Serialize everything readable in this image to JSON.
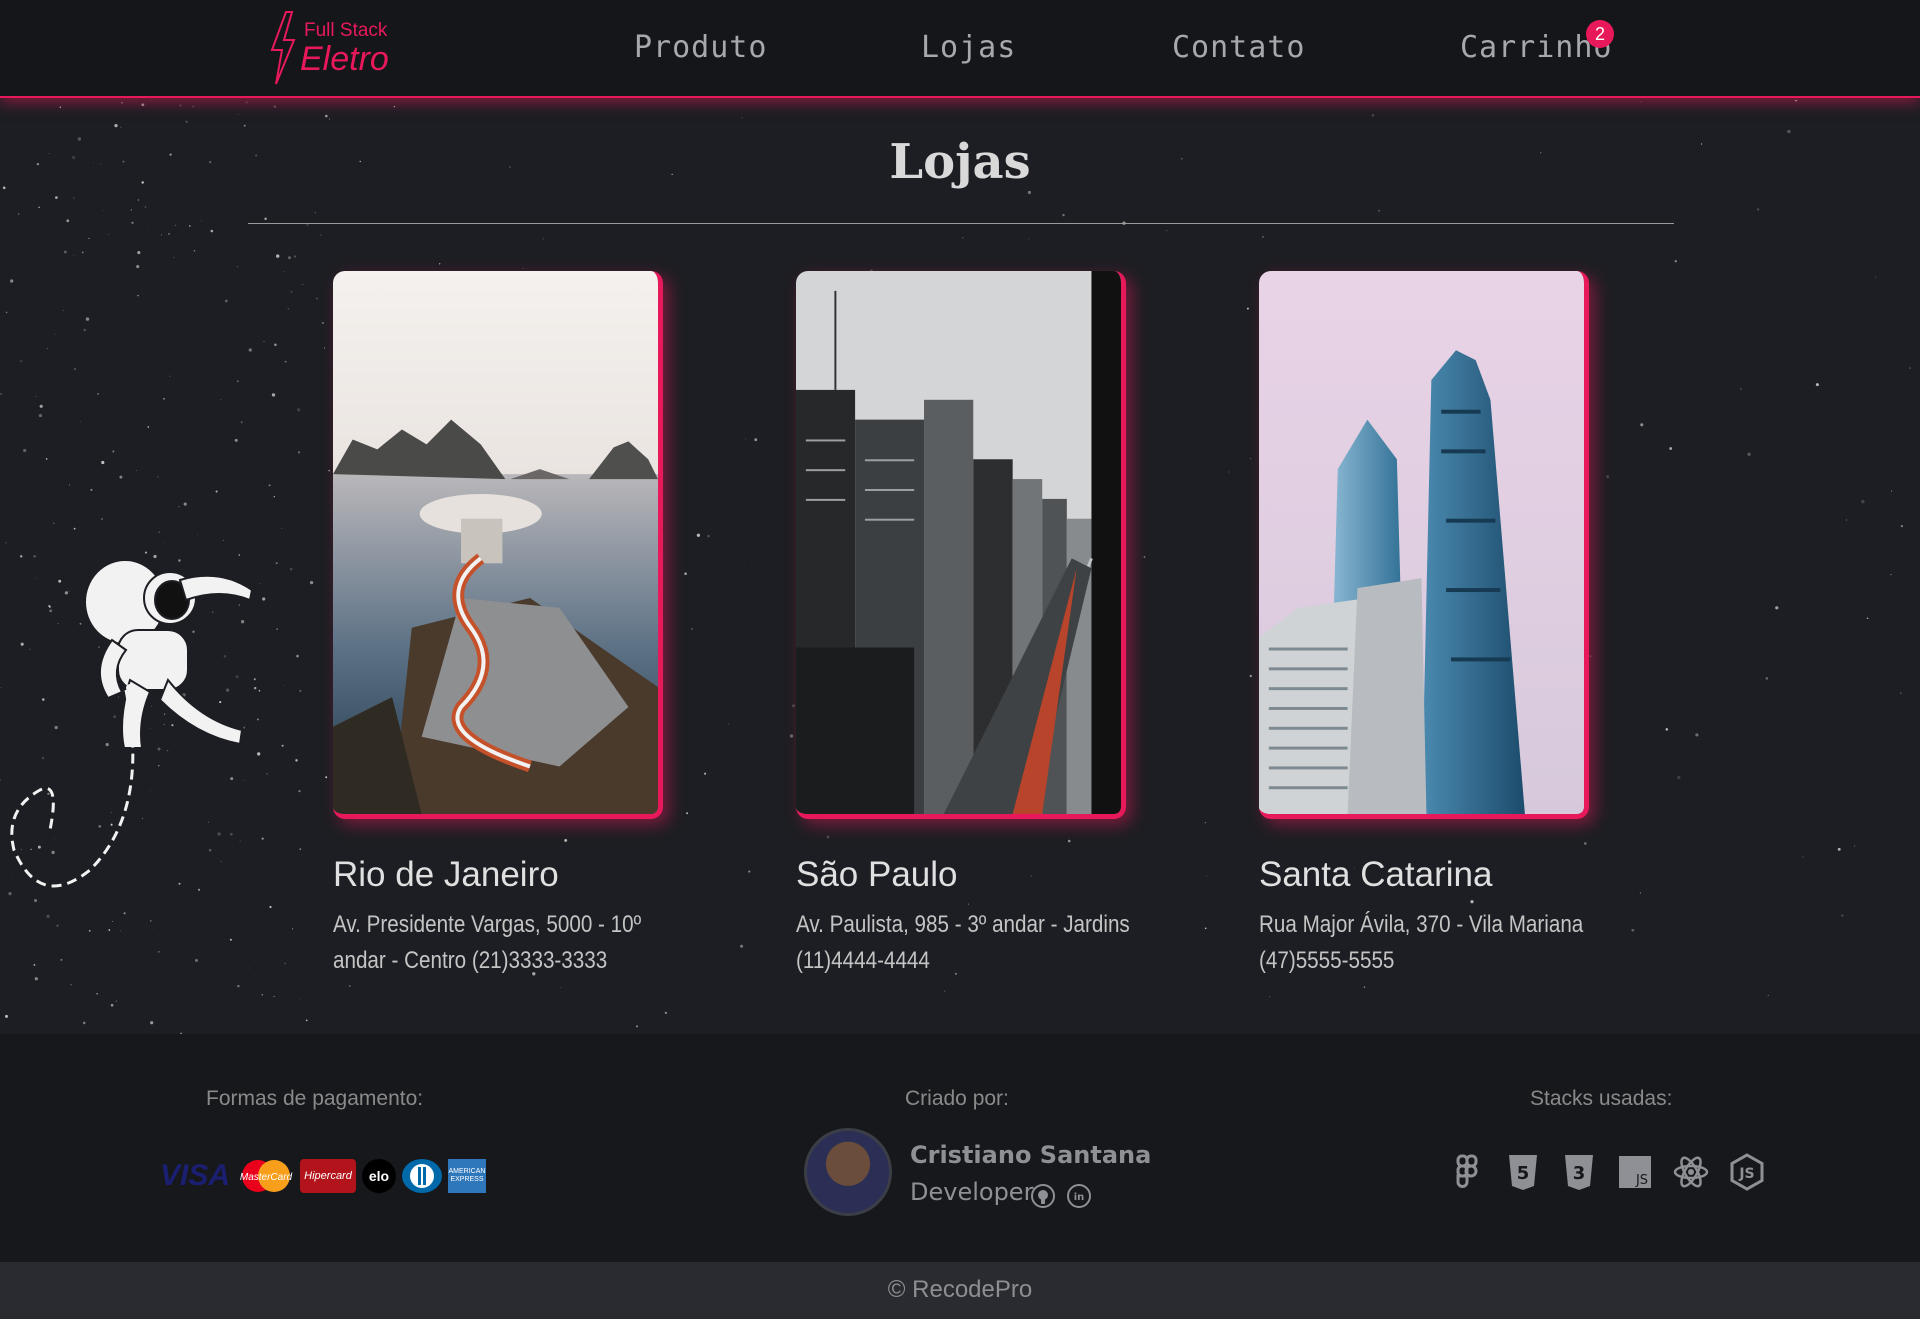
{
  "header": {
    "logo_top": "Full Stack",
    "logo_main": "Eletro",
    "nav": [
      "Produto",
      "Lojas",
      "Contato",
      "Carrinho"
    ],
    "cart_count": "2",
    "accent": "#e8195a"
  },
  "main": {
    "title": "Lojas",
    "stores": [
      {
        "city": "Rio de Janeiro",
        "address": "Av. Presidente Vargas, 5000 - 10º andar - Centro (21)3333-3333"
      },
      {
        "city": "São Paulo",
        "address": "Av. Paulista, 985 - 3º andar - Jardins (11)4444-4444"
      },
      {
        "city": "Santa Catarina",
        "address": "Rua Major Ávila, 370 - Vila Mariana (47)5555-5555"
      }
    ]
  },
  "footer": {
    "payment_label": "Formas de pagamento:",
    "payment_methods": [
      "VISA",
      "MasterCard",
      "Hipercard",
      "elo",
      "Diners",
      "American Express"
    ],
    "creator_label": "Criado por:",
    "creator_name": "Cristiano Santana",
    "creator_role": "Developer",
    "social_icons": [
      "github-icon",
      "linkedin-icon"
    ],
    "stacks_label": "Stacks usadas:",
    "stacks": [
      "figma-icon",
      "html5-icon",
      "css3-icon",
      "javascript-icon",
      "react-icon",
      "nodejs-icon"
    ],
    "copyright": "© RecodePro"
  }
}
